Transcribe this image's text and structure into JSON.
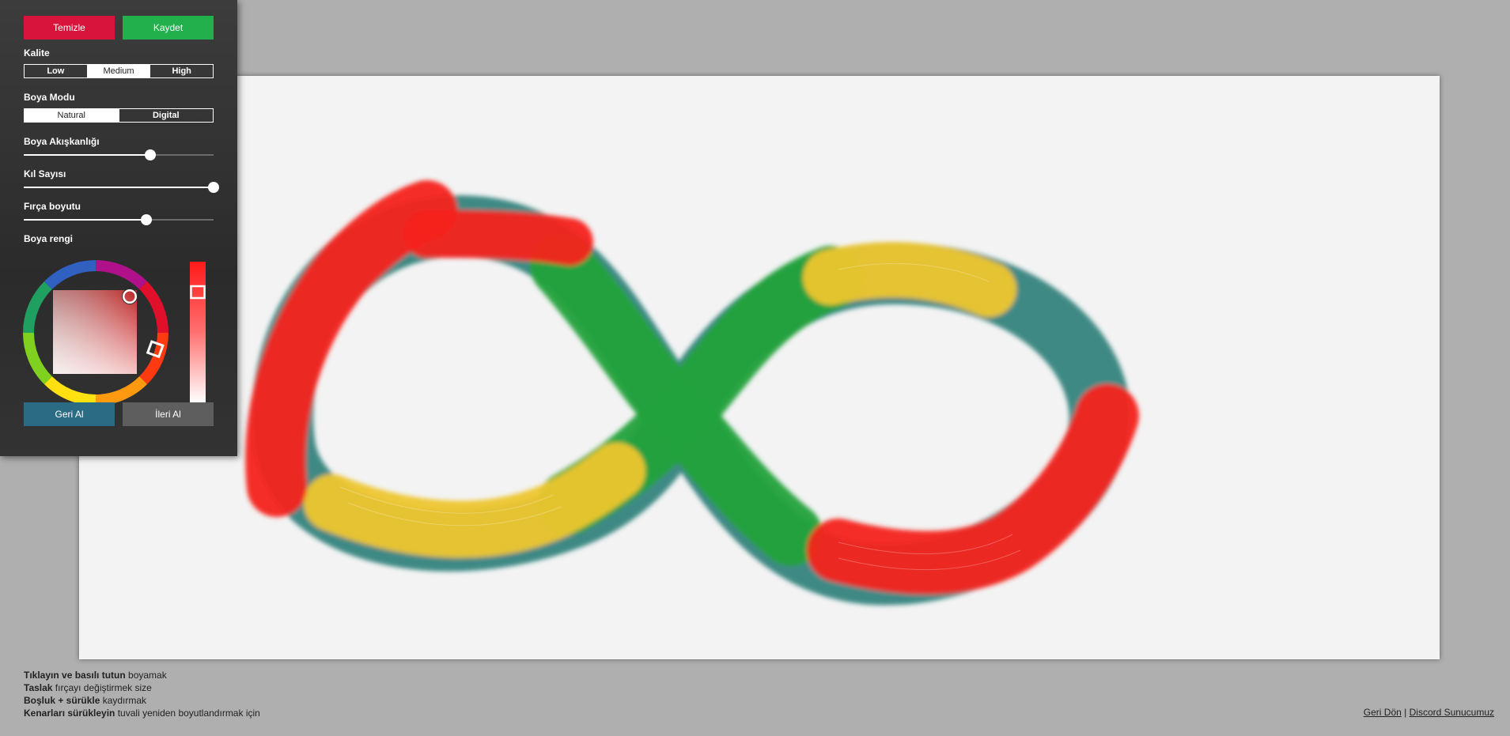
{
  "toolbar": {
    "clear_label": "Temizle",
    "save_label": "Kaydet",
    "undo_label": "Geri Al",
    "redo_label": "İleri Al"
  },
  "quality": {
    "label": "Kalite",
    "options": [
      "Low",
      "Medium",
      "High"
    ],
    "selected": "Medium"
  },
  "paint_mode": {
    "label": "Boya Modu",
    "options": [
      "Natural",
      "Digital"
    ],
    "selected": "Natural"
  },
  "sliders": {
    "fluidity": {
      "label": "Boya Akışkanlığı",
      "value_fraction": 0.67
    },
    "bristle_count": {
      "label": "Kıl Sayısı",
      "value_fraction": 1.0
    },
    "brush_size": {
      "label": "Fırça boyutu",
      "value_fraction": 0.65
    }
  },
  "color": {
    "label": "Boya rengi",
    "current_hex": "#ff1a1a"
  },
  "colors": {
    "clear_button": "#d8143a",
    "save_button": "#21b04b",
    "undo_button": "#2c6b84",
    "redo_button": "#5e5e5e",
    "stroke_red": "#f5231b",
    "stroke_teal": "#1f7771",
    "stroke_green": "#23a23c",
    "stroke_yellow": "#eec62e"
  },
  "help": {
    "line1_bold": "Tıklayın ve basılı tutun",
    "line1_rest": " boyamak",
    "line2_bold": "Taslak",
    "line2_rest": " fırçayı değiştirmek size",
    "line3_bold": "Boşluk + sürükle",
    "line3_rest": " kaydırmak",
    "line4_bold": "Kenarları sürükleyin",
    "line4_rest": " tuvali yeniden boyutlandırmak için"
  },
  "links": {
    "back": "Geri Dön",
    "separator": " | ",
    "discord": "Discord Sunucumuz"
  }
}
